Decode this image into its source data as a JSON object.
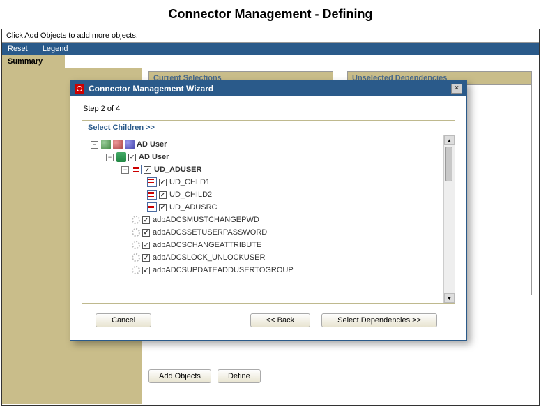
{
  "page_title": "Connector Management - Defining",
  "hint": "Click Add Objects to add more objects.",
  "menu": {
    "reset": "Reset",
    "legend": "Legend"
  },
  "summary_tab": "Summary",
  "panels": {
    "current": "Current Selections",
    "unselected": "Unselected Dependencies"
  },
  "actions": {
    "add": "Add Objects",
    "define": "Define"
  },
  "wizard": {
    "title": "Connector Management Wizard",
    "step": "Step 2 of 4",
    "select_header": "Select Children >>",
    "cancel": "Cancel",
    "back": "<< Back",
    "next": "Select Dependencies >>",
    "tree": [
      {
        "indent": 0,
        "toggle": "-",
        "icons": [
          "folder1",
          "folder2",
          "folder3"
        ],
        "checkbox": false,
        "label": "AD User",
        "bold": true
      },
      {
        "indent": 1,
        "toggle": "-",
        "icons": [
          "stack"
        ],
        "checkbox": true,
        "label": "AD User",
        "bold": true
      },
      {
        "indent": 2,
        "toggle": "-",
        "icons": [
          "doc"
        ],
        "checkbox": true,
        "label": "UD_ADUSER",
        "bold": true
      },
      {
        "indent": 3,
        "toggle": "",
        "icons": [
          "doc"
        ],
        "checkbox": true,
        "label": "UD_CHLD1",
        "bold": false
      },
      {
        "indent": 3,
        "toggle": "",
        "icons": [
          "doc"
        ],
        "checkbox": true,
        "label": "UD_CHILD2",
        "bold": false
      },
      {
        "indent": 3,
        "toggle": "",
        "icons": [
          "doc"
        ],
        "checkbox": true,
        "label": "UD_ADUSRC",
        "bold": false
      },
      {
        "indent": 2,
        "toggle": "",
        "icons": [
          "gear"
        ],
        "checkbox": true,
        "label": "adpADCSMUSTCHANGEPWD",
        "bold": false
      },
      {
        "indent": 2,
        "toggle": "",
        "icons": [
          "gear"
        ],
        "checkbox": true,
        "label": "adpADCSSETUSERPASSWORD",
        "bold": false
      },
      {
        "indent": 2,
        "toggle": "",
        "icons": [
          "gear"
        ],
        "checkbox": true,
        "label": "adpADCSCHANGEATTRIBUTE",
        "bold": false
      },
      {
        "indent": 2,
        "toggle": "",
        "icons": [
          "gear"
        ],
        "checkbox": true,
        "label": "adpADCSLOCK_UNLOCKUSER",
        "bold": false
      },
      {
        "indent": 2,
        "toggle": "",
        "icons": [
          "gear"
        ],
        "checkbox": true,
        "label": "adpADCSUPDATEADDUSERTOGROUP",
        "bold": false
      }
    ]
  }
}
